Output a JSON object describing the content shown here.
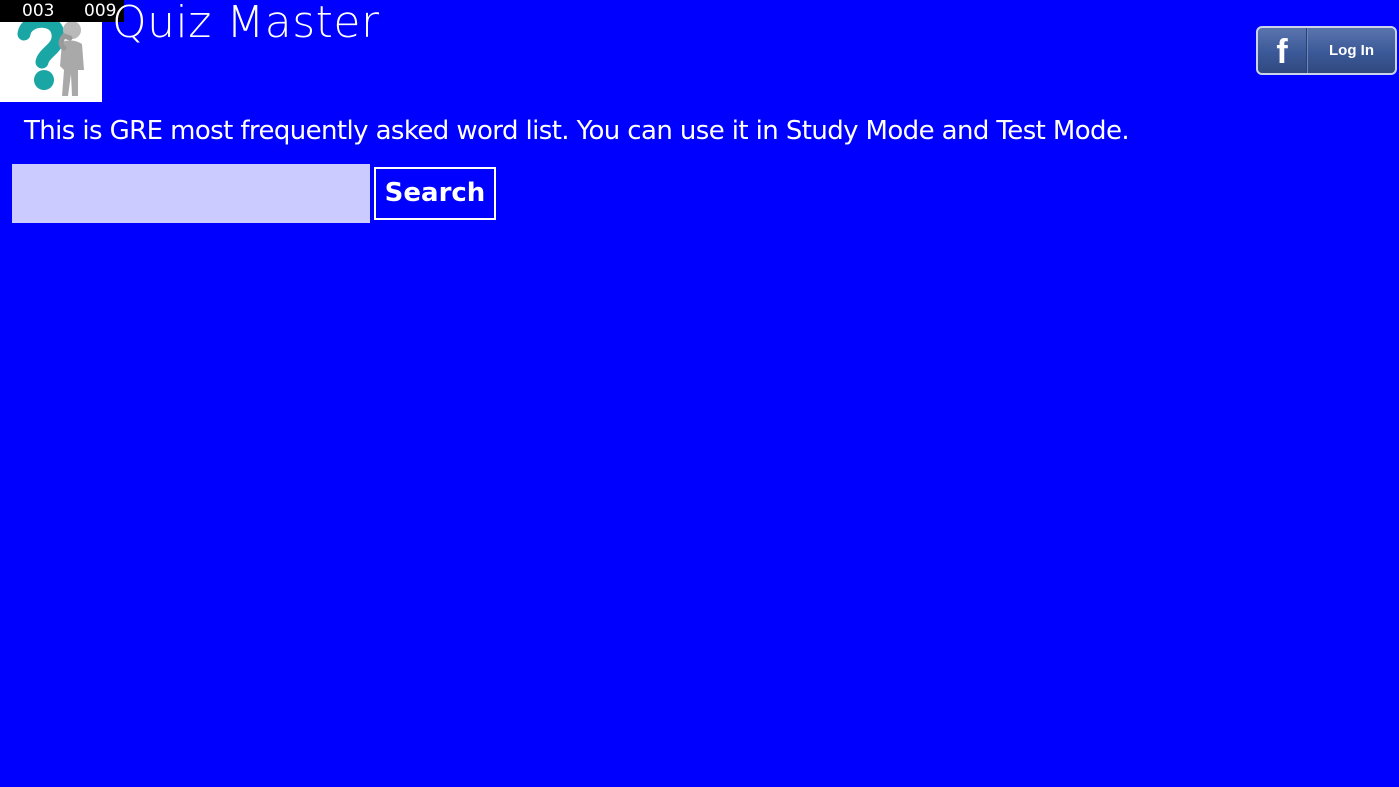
{
  "app": {
    "title": "Quiz Master",
    "background_color": "#0000FF",
    "logo_icon": "thinking-figure-question-mark-icon"
  },
  "debug_overlay": {
    "counter_1": "003",
    "counter_2": "009"
  },
  "facebook": {
    "icon": "facebook-f-icon",
    "glyph": "f",
    "label": "Log In",
    "color": "#3b5998"
  },
  "main": {
    "description": "This is GRE most frequently asked word list. You can use it in Study Mode and Test Mode."
  },
  "search": {
    "value": "",
    "placeholder": "",
    "input_color": "#cbcbff",
    "button_label": "Search"
  }
}
